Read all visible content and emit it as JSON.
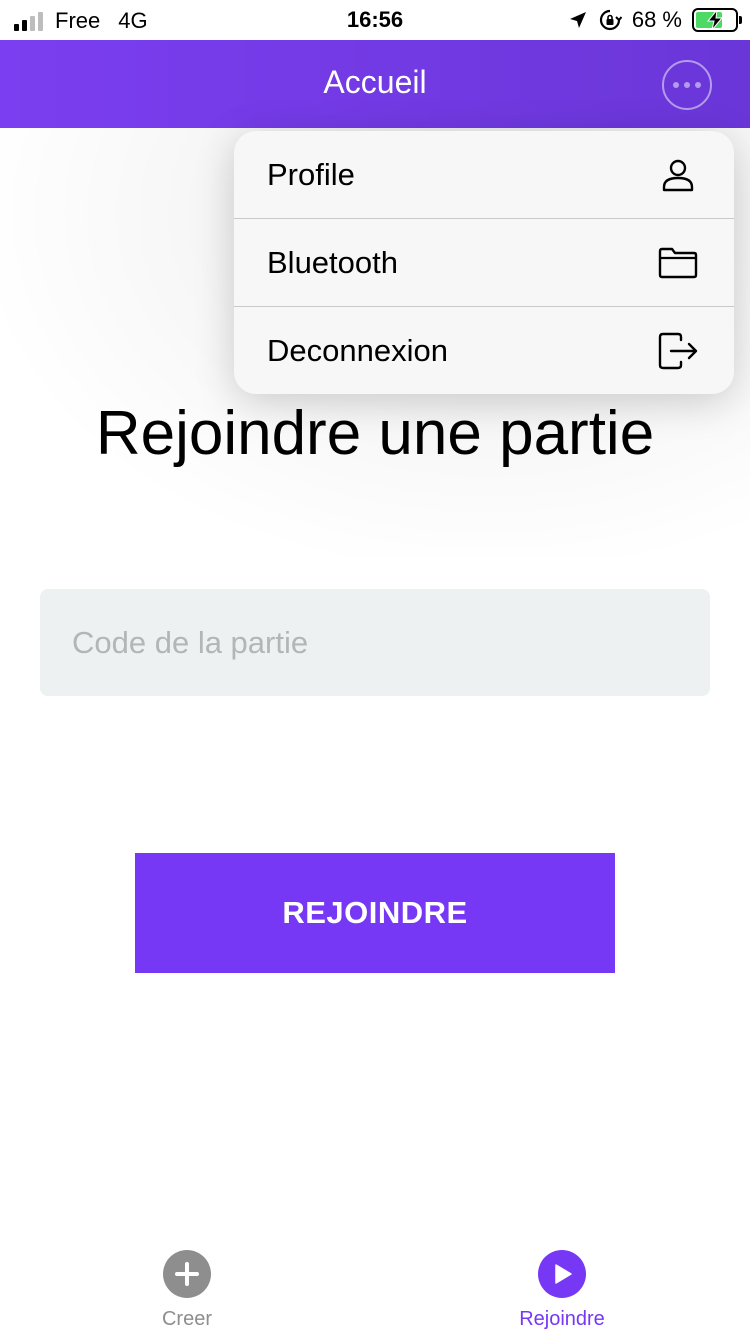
{
  "status_bar": {
    "carrier": "Free",
    "network": "4G",
    "time": "16:56",
    "battery": "68 %",
    "battery_level": 0.68
  },
  "header": {
    "title": "Accueil",
    "more_icon": "ellipsis-circle-icon"
  },
  "menu": {
    "items": [
      {
        "label": "Profile",
        "icon": "person-icon"
      },
      {
        "label": "Bluetooth",
        "icon": "folder-icon"
      },
      {
        "label": "Deconnexion",
        "icon": "logout-icon"
      }
    ]
  },
  "main": {
    "title": "Rejoindre une partie",
    "code_placeholder": "Code de la partie",
    "code_value": "",
    "join_button": "REJOINDRE"
  },
  "tabbar": {
    "tabs": [
      {
        "label": "Creer",
        "icon": "plus-circle-icon",
        "active": false
      },
      {
        "label": "Rejoindre",
        "icon": "play-circle-icon",
        "active": true
      }
    ]
  },
  "colors": {
    "accent": "#7638f5",
    "header": "#7b3ef0",
    "inactive": "#8e8e8e",
    "input_bg": "#eef1f2"
  }
}
